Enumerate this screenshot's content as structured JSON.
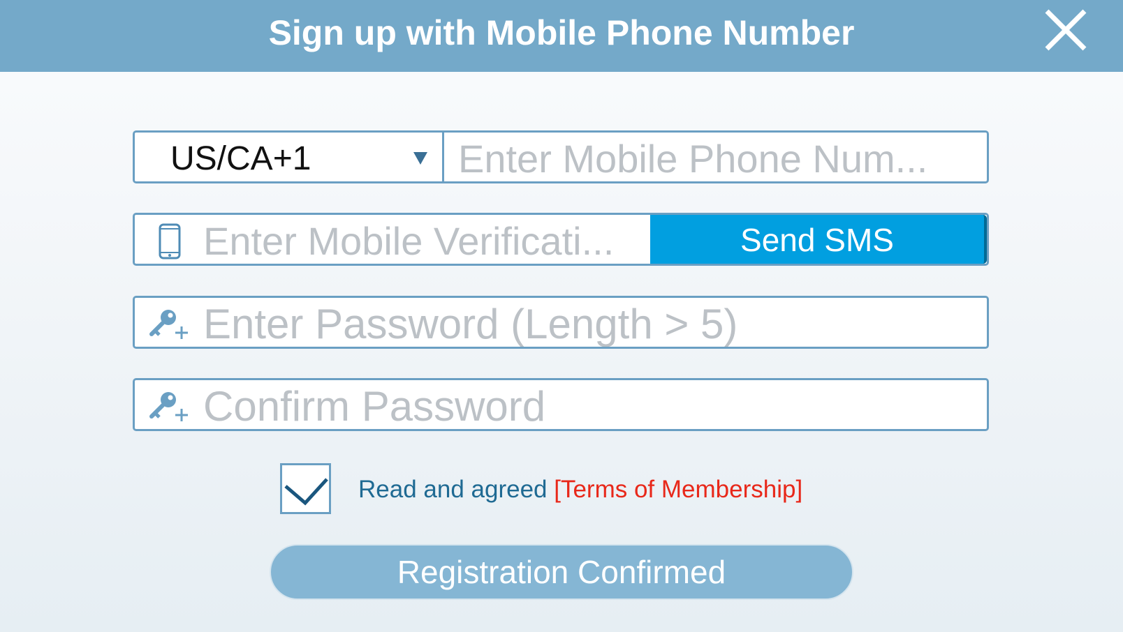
{
  "header": {
    "title": "Sign up with Mobile Phone Number",
    "close_icon": "close-icon"
  },
  "phone": {
    "country_code": "US/CA+1",
    "placeholder": "Enter Mobile Phone Num..."
  },
  "verification": {
    "icon": "mobile-phone-icon",
    "placeholder": "Enter Mobile Verificati...",
    "send_label": "Send SMS"
  },
  "password": {
    "icon": "key-add-icon",
    "placeholder": "Enter Password (Length > 5)"
  },
  "confirm_password": {
    "icon": "key-add-icon",
    "placeholder": "Confirm Password"
  },
  "agreement": {
    "checked": true,
    "text": "Read and agreed ",
    "link": "[Terms of Membership]"
  },
  "submit": {
    "label": "Registration Confirmed"
  },
  "colors": {
    "header": "#74a9c9",
    "field_border": "#6a9fc3",
    "send_button": "#019fe0",
    "link": "#e8281a",
    "submit_button": "#85b6d4"
  }
}
